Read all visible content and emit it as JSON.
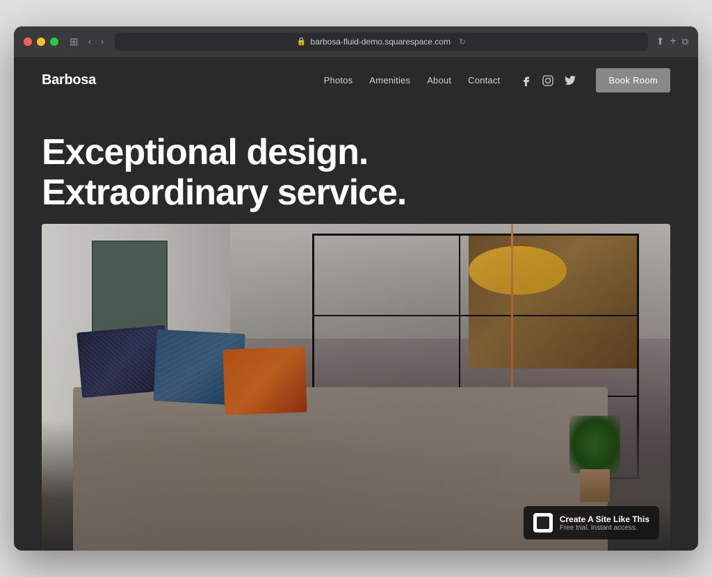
{
  "browser": {
    "url": "barbosa-fluid-demo.squarespace.com",
    "traffic_lights": [
      "red",
      "yellow",
      "green"
    ]
  },
  "website": {
    "brand": "Barbosa",
    "nav": {
      "links": [
        {
          "label": "Photos",
          "href": "#"
        },
        {
          "label": "Amenities",
          "href": "#"
        },
        {
          "label": "About",
          "href": "#"
        },
        {
          "label": "Contact",
          "href": "#"
        }
      ],
      "book_button": "Book Room"
    },
    "hero": {
      "headline_line1": "Exceptional design.",
      "headline_line2": "Extraordinary service."
    },
    "squarespace_badge": {
      "title": "Create A Site Like This",
      "subtitle": "Free trial. Instant access."
    }
  }
}
